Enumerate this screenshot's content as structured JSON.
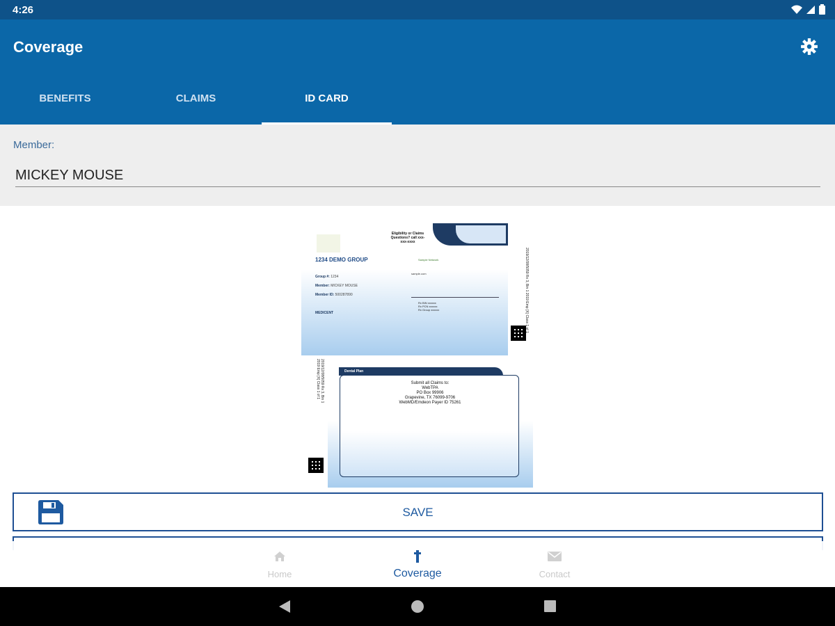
{
  "status_bar": {
    "time": "4:26"
  },
  "app_bar": {
    "title": "Coverage"
  },
  "tabs": [
    {
      "label": "BENEFITS",
      "active": false
    },
    {
      "label": "CLAIMS",
      "active": false
    },
    {
      "label": "ID CARD",
      "active": true
    }
  ],
  "member": {
    "label": "Member:",
    "value": "MICKEY MOUSE"
  },
  "id_card": {
    "front": {
      "contact_text": "Eligibility or Claims Questions? call xxx-xxx-xxxx",
      "group_name": "1234 DEMO GROUP",
      "group_label": "Group #:",
      "group_value": "1234",
      "member_label": "Member:",
      "member_value": "MICKEY MOUSE",
      "member_id_label": "Member ID:",
      "member_id_value": "500287890",
      "coverage_label": "MEDICENT",
      "partner_text": "Sample Network",
      "url_text": "sample.com",
      "rx_text": "Rx BIN xxxxxx\nRx PCN xxxxxx\nRx Group xxxxxx",
      "barcode_text": "2019/12/08/5059 Rx 3, Bin 1\n2019 Emp [X] Class 1 of 1"
    },
    "back": {
      "header_text": "Dental Plan",
      "body_text": "Submit all Claims to:\nWebTPA\nPO Box 99906\nGrapevine, TX 76099-9706\nWebMD/Emdeon Payer ID 75261",
      "barcode_text": "2019/12/08/5059 Rx 3, Bin 1\n2019 Emp [X] Class 1 of 1"
    }
  },
  "save_button": {
    "label": "SAVE",
    "icon": "floppy-disk-icon"
  },
  "bottom_nav": [
    {
      "label": "Home",
      "icon": "home-icon",
      "active": false
    },
    {
      "label": "Coverage",
      "icon": "coverage-icon",
      "active": true
    },
    {
      "label": "Contact",
      "icon": "mail-icon",
      "active": false
    }
  ],
  "colors": {
    "status_bar": "#0e5289",
    "app_bar": "#0b67a8",
    "accent": "#1e5aa0",
    "panel": "#eeeeee"
  }
}
